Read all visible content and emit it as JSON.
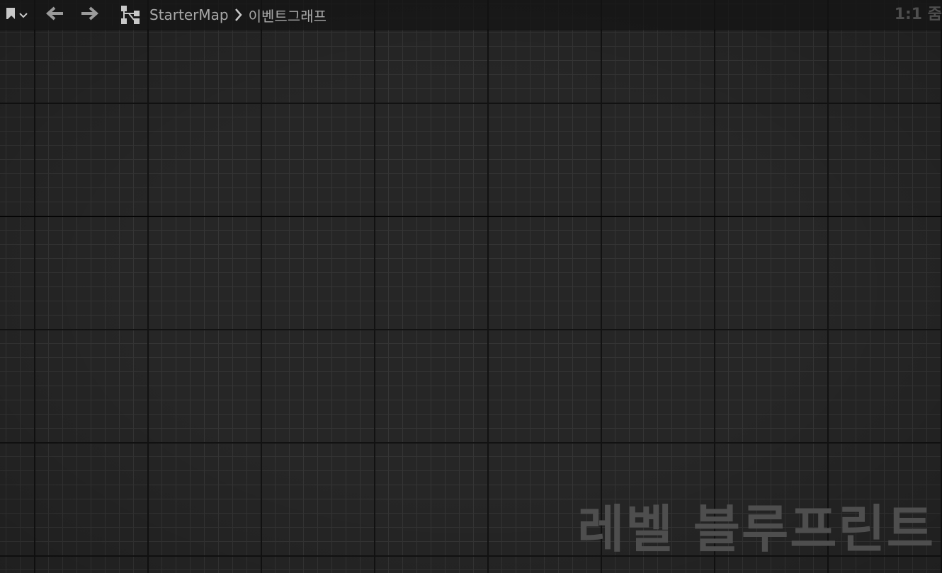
{
  "toolbar": {
    "bookmark_icon": "bookmark-icon",
    "dropdown_icon": "chevron-down-icon",
    "back_icon": "arrow-left-icon",
    "forward_icon": "arrow-right-icon",
    "graph_icon": "graph-hierarchy-icon",
    "breadcrumbs": [
      "StarterMap",
      "이벤트그래프"
    ],
    "zoom_label": "1:1 줌"
  },
  "canvas": {
    "watermark": "레벨 블루프린트"
  },
  "colors": {
    "canvas_bg": "#262626",
    "grid_minor": "#353535",
    "grid_major": "#121212",
    "text": "#a8a8a8",
    "watermark": "#4e4e4e"
  }
}
